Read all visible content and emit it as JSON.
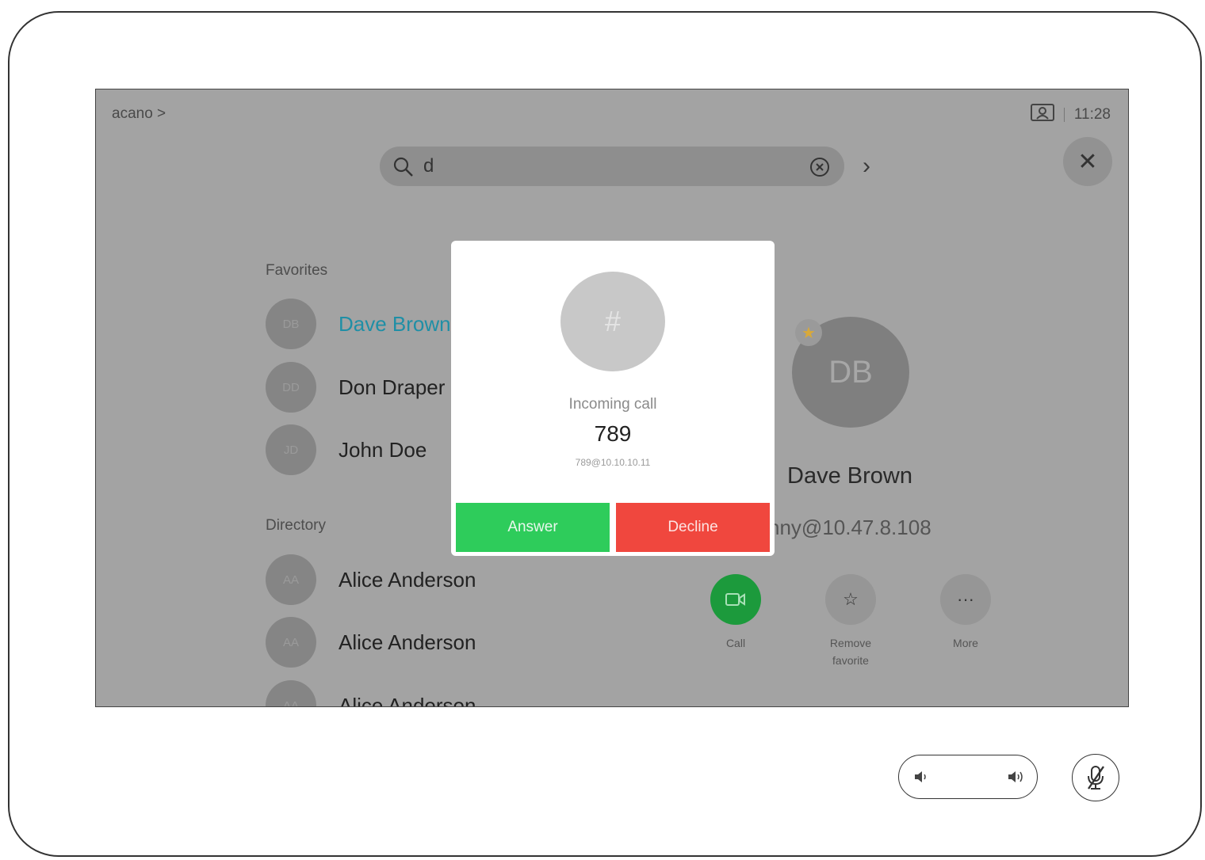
{
  "header": {
    "brand": "acano >",
    "time": "11:28"
  },
  "search": {
    "query": "d"
  },
  "favorites": {
    "title": "Favorites",
    "items": [
      {
        "initials": "DB",
        "name": "Dave Brown",
        "active": true
      },
      {
        "initials": "DD",
        "name": "Don Draper",
        "active": false
      },
      {
        "initials": "JD",
        "name": "John Doe",
        "active": false
      }
    ]
  },
  "directory": {
    "title": "Directory",
    "items": [
      {
        "initials": "AA",
        "name": "Alice Anderson"
      },
      {
        "initials": "AA",
        "name": "Alice Anderson"
      },
      {
        "initials": "AA",
        "name": "Alice Anderson"
      }
    ]
  },
  "detail": {
    "initials": "DB",
    "name": "Dave Brown",
    "uri": "nny@10.47.8.108",
    "actions": {
      "call": "Call",
      "remove_favorite": "Remove\nfavorite",
      "more": "More"
    }
  },
  "incoming_call": {
    "avatar_symbol": "#",
    "label": "Incoming call",
    "number": "789",
    "uri": "789@10.10.10.11",
    "answer": "Answer",
    "decline": "Decline"
  },
  "colors": {
    "answer": "#2ecc5b",
    "decline": "#f0473e",
    "call": "#1c9a3c",
    "accent": "#1f8fa6"
  }
}
